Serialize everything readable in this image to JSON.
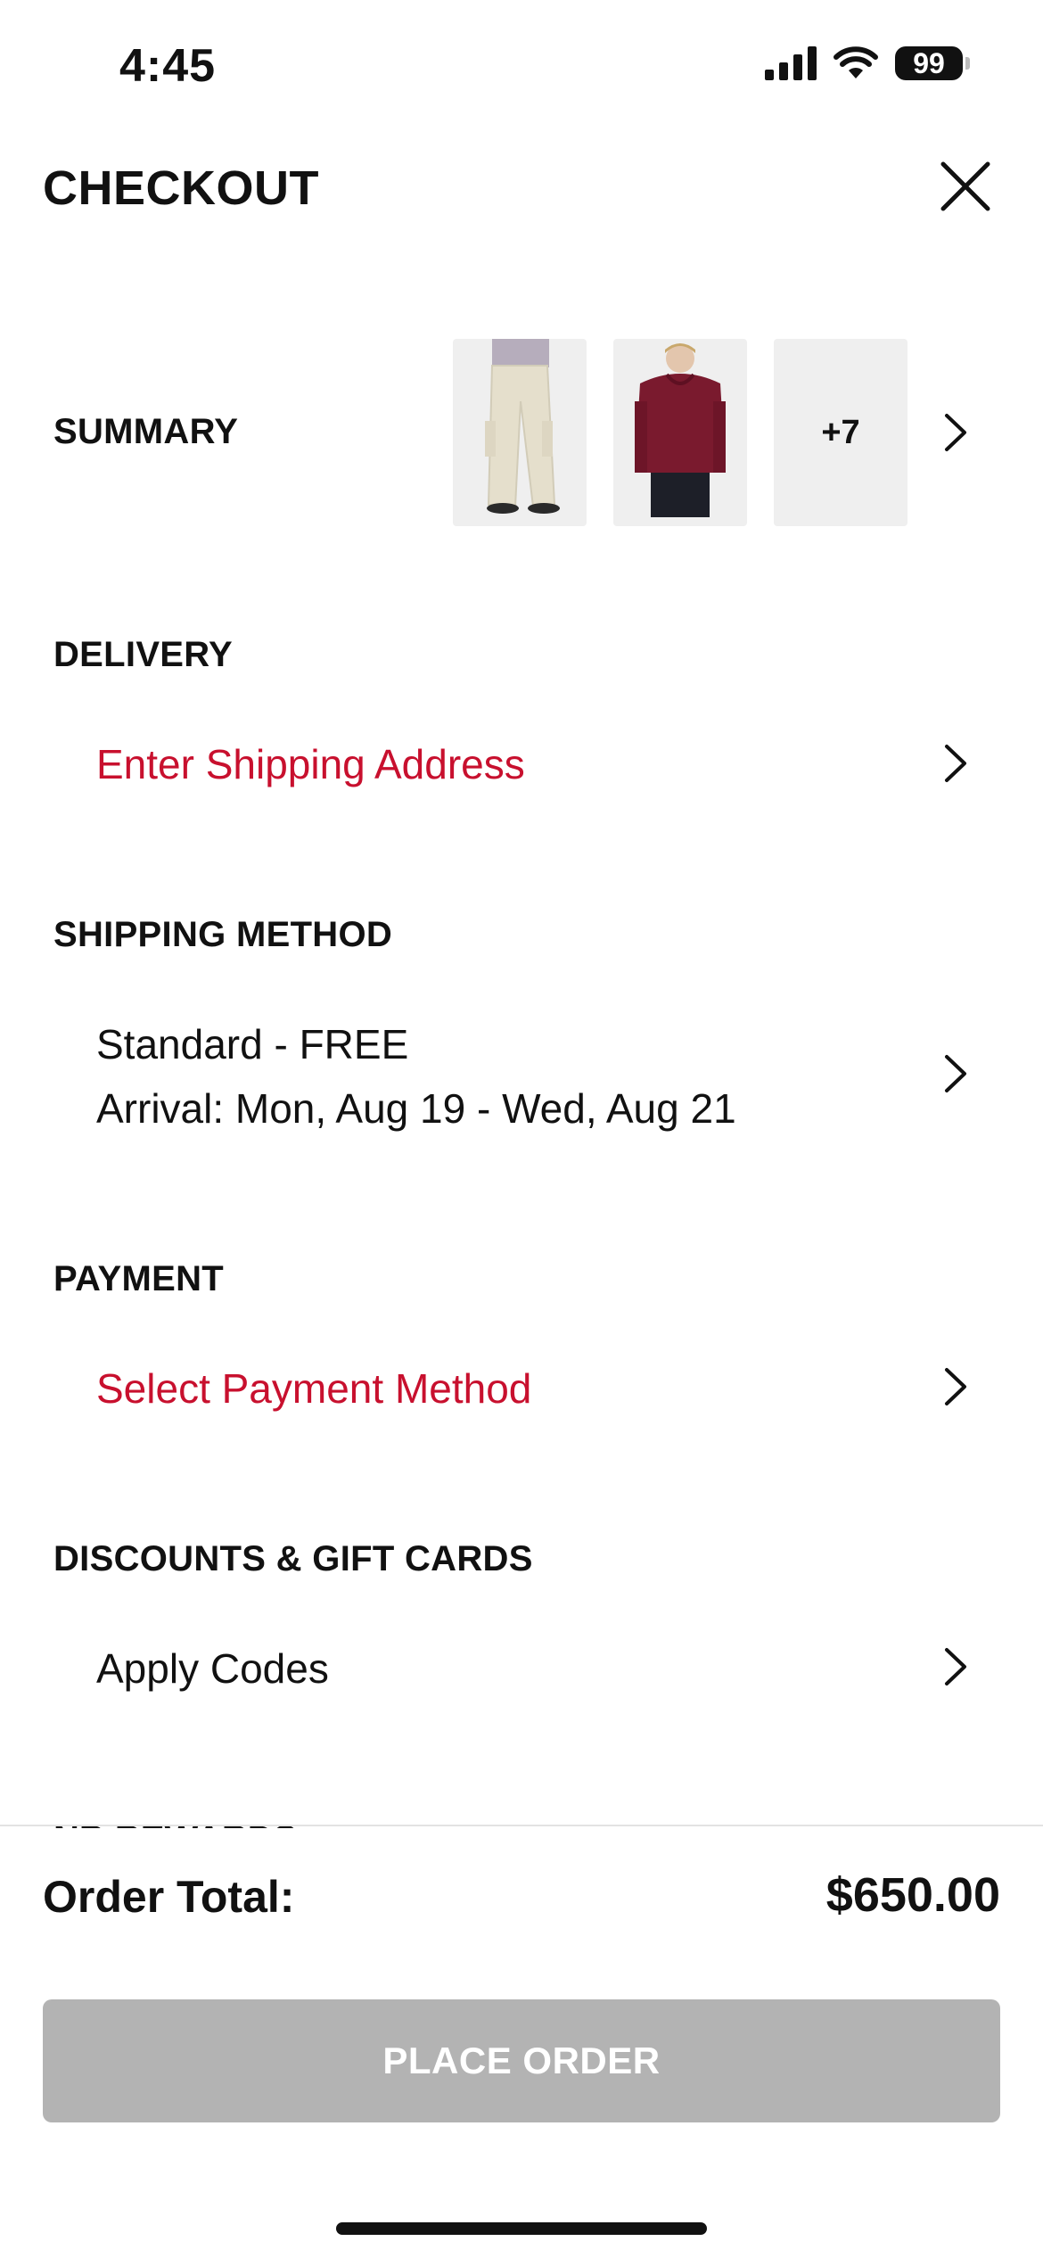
{
  "status_bar": {
    "time": "4:45",
    "battery": "99"
  },
  "header": {
    "title": "CHECKOUT"
  },
  "summary": {
    "label": "SUMMARY",
    "more_count": "+7",
    "thumbnails": [
      "cargo pants",
      "burgundy hoodie"
    ]
  },
  "delivery": {
    "label": "DELIVERY",
    "action": "Enter Shipping Address"
  },
  "shipping_method": {
    "label": "SHIPPING METHOD",
    "line1": "Standard - FREE",
    "line2": "Arrival: Mon, Aug 19 - Wed, Aug 21"
  },
  "payment": {
    "label": "PAYMENT",
    "action": "Select Payment Method"
  },
  "discounts": {
    "label": "DISCOUNTS & GIFT CARDS",
    "action": "Apply Codes"
  },
  "rewards": {
    "label": "NB REWARDS"
  },
  "footer": {
    "order_total_label": "Order Total:",
    "order_total_value": "$650.00",
    "place_order_label": "PLACE ORDER"
  },
  "colors": {
    "accent_red": "#c8102e",
    "disabled_button": "#b3b3b3"
  }
}
